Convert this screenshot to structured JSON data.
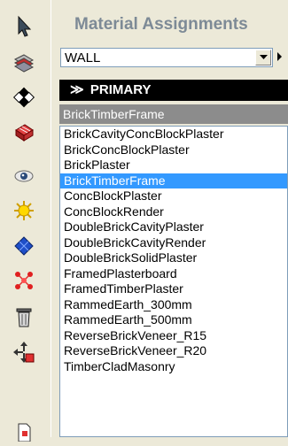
{
  "toolbar": {
    "tools": [
      {
        "icon": "pointer-icon"
      },
      {
        "icon": "layers-material-icon"
      },
      {
        "icon": "checker-material-icon"
      },
      {
        "icon": "brick-material-icon"
      },
      {
        "icon": "eye-visibility-icon"
      },
      {
        "icon": "sun-light-icon"
      },
      {
        "icon": "blue-tile-material-icon"
      },
      {
        "icon": "node-network-icon"
      },
      {
        "icon": "trash-bin-icon"
      },
      {
        "icon": "move-arrows-icon"
      },
      {
        "icon": "document-icon"
      }
    ]
  },
  "panel": {
    "title": "Material Assignments",
    "element_type": "WALL",
    "section_header": "PRIMARY",
    "current_material": "BrickTimberFrame",
    "materials": [
      "BrickCavityConcBlockPlaster",
      "BrickConcBlockPlaster",
      "BrickPlaster",
      "BrickTimberFrame",
      "ConcBlockPlaster",
      "ConcBlockRender",
      "DoubleBrickCavityPlaster",
      "DoubleBrickCavityRender",
      "DoubleBrickSolidPlaster",
      "FramedPlasterboard",
      "FramedTimberPlaster",
      "RammedEarth_300mm",
      "RammedEarth_500mm",
      "ReverseBrickVeneer_R15",
      "ReverseBrickVeneer_R20",
      "TimberCladMasonry"
    ],
    "selected_index": 3
  },
  "colors": {
    "selection": "#3399ff",
    "header_bg": "#000000",
    "title": "#7d8a96"
  }
}
